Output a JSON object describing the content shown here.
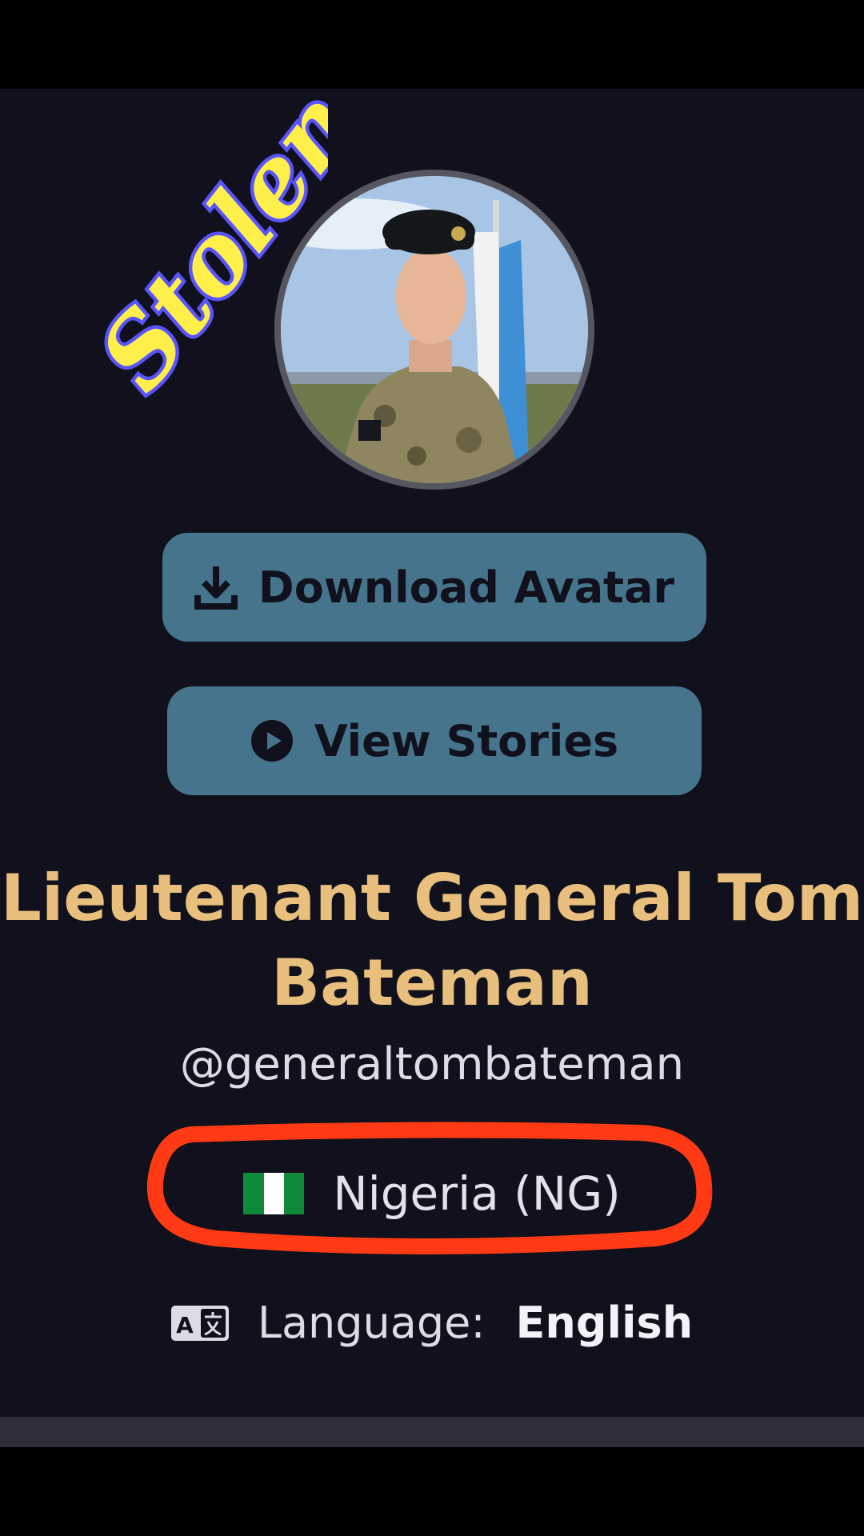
{
  "overlay": {
    "stamp_text": "Stolen"
  },
  "profile": {
    "name": "Lieutenant General Tom Bateman",
    "handle": "@generaltombateman",
    "country": {
      "label": "Nigeria (NG)",
      "flag_colors": [
        "#0f8a3a",
        "#ffffff",
        "#0f8a3a"
      ]
    },
    "language": {
      "label": "Language:",
      "value": "English"
    }
  },
  "actions": {
    "download_avatar": "Download Avatar",
    "view_stories": "View Stories"
  },
  "colors": {
    "background": "#10111c",
    "button": "#46748c",
    "name": "#e8bf7c",
    "annotation": "#ff3a14"
  },
  "icons": {
    "download": "download-icon",
    "play": "play-circle-icon",
    "translate": "translate-icon"
  }
}
